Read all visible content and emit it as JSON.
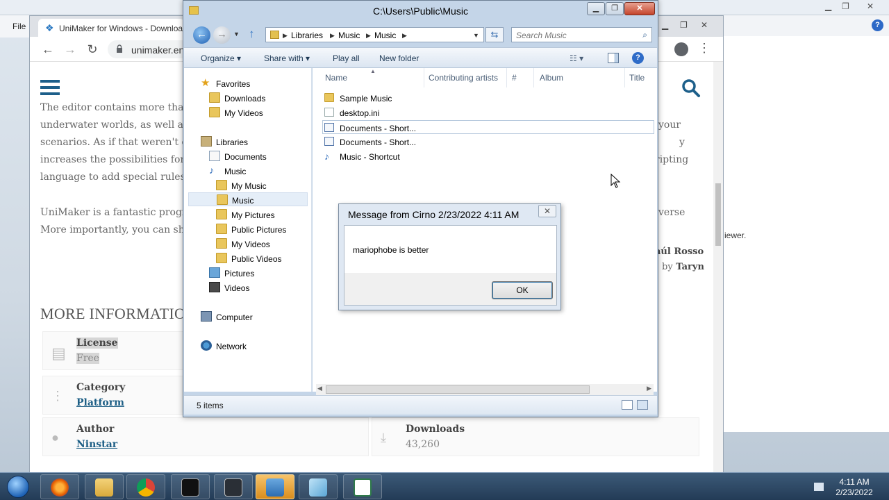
{
  "background": {
    "file_menu": "File",
    "right_snippet": "iewer.",
    "help_glyph": "?"
  },
  "browser": {
    "tab_title": "UniMaker for Windows - Download",
    "url": "unimaker.en",
    "paragraph_lines": [
      "The editor contains more than",
      "underwater worlds, as well as",
      "scenarios. As if that weren't en",
      "increases the possibilities for",
      "language to add special rules"
    ],
    "paragraph_right_lines": [
      "your",
      "",
      "y",
      "ripting"
    ],
    "paragraph2_lines": [
      "UniMaker is a fantastic progra",
      "More importantly, you can sha"
    ],
    "paragraph2_right": "verse",
    "credit_1": "aúl Rosso",
    "credit_2_by": "by",
    "credit_2_name": "Taryn",
    "more_info_heading": "MORE INFORMATION",
    "info": {
      "license_key": "License",
      "license_value": "Free",
      "category_key": "Category",
      "category_value": "Platform",
      "author_key": "Author",
      "author_value": "Ninstar",
      "downloads_key": "Downloads",
      "downloads_value": "43,260"
    }
  },
  "explorer": {
    "title": "C:\\Users\\Public\\Music",
    "breadcrumb": [
      "Libraries",
      "Music",
      "Music"
    ],
    "search_placeholder": "Search Music",
    "commands": {
      "organize": "Organize ▾",
      "share_with": "Share with ▾",
      "play_all": "Play all",
      "new_folder": "New folder"
    },
    "nav": {
      "favorites": "Favorites",
      "downloads": "Downloads",
      "my_videos_fav": "My Videos",
      "libraries": "Libraries",
      "documents": "Documents",
      "music": "Music",
      "my_music": "My Music",
      "music_sub": "Music",
      "my_pictures": "My Pictures",
      "public_pictures": "Public Pictures",
      "my_videos": "My Videos",
      "public_videos": "Public Videos",
      "pictures": "Pictures",
      "videos": "Videos",
      "computer": "Computer",
      "network": "Network"
    },
    "columns": {
      "name": "Name",
      "contributing_artists": "Contributing artists",
      "number": "#",
      "album": "Album",
      "title": "Title"
    },
    "files": [
      {
        "name": "Sample Music",
        "kind": "folder"
      },
      {
        "name": "desktop.ini",
        "kind": "ini"
      },
      {
        "name": "Documents - Short...",
        "kind": "shortcut"
      },
      {
        "name": "Documents - Short...",
        "kind": "shortcut"
      },
      {
        "name": "Music - Shortcut",
        "kind": "music-shortcut"
      }
    ],
    "status": "5 items"
  },
  "dialog": {
    "title": "Message from Cirno 2/23/2022 4:11 AM",
    "message": "mariophobe is better",
    "ok_label": "OK",
    "close_glyph": "✕"
  },
  "taskbar": {
    "time": "4:11 AM",
    "date": "2/23/2022"
  },
  "colors": {
    "aero_title": "#c4d5e8",
    "link_blue": "#1e5f86",
    "taskbar": "#233b56"
  }
}
